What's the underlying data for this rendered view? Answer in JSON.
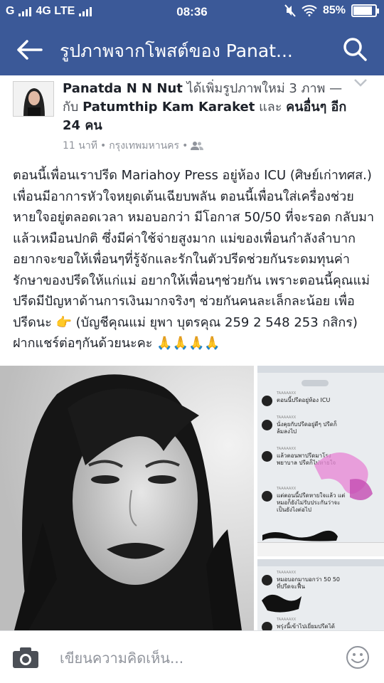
{
  "status_bar": {
    "carrier_left": "G",
    "network": "4G LTE",
    "time": "08:36",
    "battery": "85%",
    "battery_level": 0.85
  },
  "app_bar": {
    "title": "รูปภาพจากโพสต์ของ Panat...",
    "back_icon": "back-arrow-icon",
    "search_icon": "search-icon"
  },
  "post": {
    "author": "Panatda N N Nut",
    "action_text": "ได้เพิ่มรูปภาพใหม่ 3 ภาพ — กับ",
    "tagged": "Patumthip Kam Karaket",
    "and_text": "และ",
    "others": "คนอื่นๆ อีก 24 คน",
    "time": "11 นาที",
    "location": "กรุงเทพมหานคร",
    "audience_icon": "friends-icon",
    "body": "ตอนนี้เพื่อนเราปรีด Mariahoy Press อยู่ห้อง ICU (ศิษย์เก่าทศส.) เพื่อนมีอาการหัวใจหยุดเต้นเฉียบพลัน ตอนนี้เพื่อนใส่เครื่องช่วยหายใจอยู่ตลอดเวลา หมอบอกว่า มีโอกาส 50/50 ที่จะรอด กลับมาแล้วเหมือนปกติ ซึ่งมีค่าใช้จ่ายสูงมาก แม่ของเพื่อนกำลังลำบาก อยากจะขอให้เพื่อนๆที่รู้จักและรักในตัวปรีดช่วยกันระดมทุนค่ารักษาของปรีดให้แก่แม่ อยากให้เพื่อนๆช่วยกัน เพราะตอนนี้คุณแม่ปรีดมีปัญหาด้านการเงินมากจริงๆ ช่วยกันคนละเล็กละน้อย เพื่อปรีดนะ 👉 (บัญชีคุณแม่ ยุพา บุตรคุณ 259 2 548 253 กสิกร) ฝากแชร์ต่อๆกันด้วยนะคะ 🙏🙏🙏🙏"
  },
  "chat_screenshot_1": {
    "pill": "",
    "messages": [
      {
        "name": "TAAAAAXX",
        "text": "ตอนนี้ปรีดอยู่ห้อง ICU"
      },
      {
        "name": "TAAAAAXX",
        "text": "นั่งคุยกับปรีดอยู่ดีๆ ปรีดก็ล้มลงไป"
      },
      {
        "name": "TAAAAAXX",
        "text": "แล้วตอนพาปรีดมาโรงพยาบาล ปรีดก็ไม่หายใจ"
      },
      {
        "name": "TAAAAAXX",
        "text": "แต่ตอนนี้ปรีดหายใจแล้ว แต่หมอก็ยังไม่รับประกันว่าจะเป็นยังไงต่อไป"
      }
    ]
  },
  "chat_screenshot_2": {
    "messages": [
      {
        "name": "TAAAAAXX",
        "text": "หมอบอกมาบอกว่า 50 50 ที่ปรีดจะฟื้น"
      },
      {
        "name": "TAAAAAXX",
        "text": "พรุ่งนี้เข้าไปเยี่ยมปรีดได้"
      }
    ]
  },
  "comment_bar": {
    "placeholder": "เขียนความคิดเห็น...",
    "camera_icon": "camera-icon",
    "emoji_icon": "emoji-icon"
  }
}
